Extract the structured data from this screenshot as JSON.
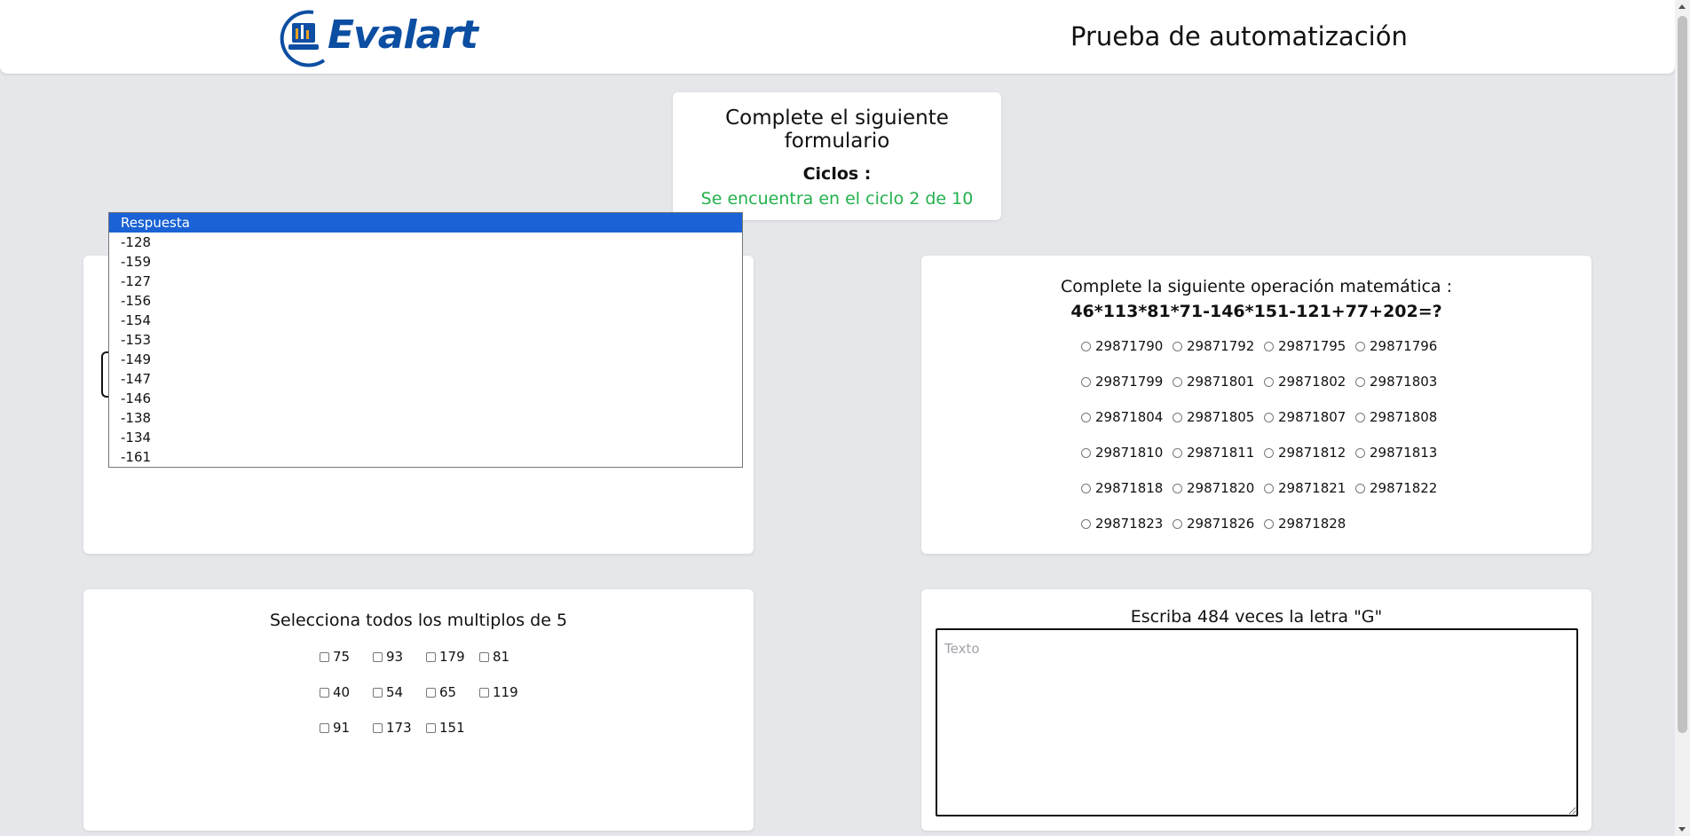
{
  "header": {
    "brand": "Evalart",
    "title": "Prueba de automatización"
  },
  "cycle": {
    "title": "Complete el siguiente formulario",
    "label": "Ciclos :",
    "status": "Se encuentra en el ciclo 2 de 10"
  },
  "dropdown": {
    "options": [
      "Respuesta",
      "-128",
      "-159",
      "-127",
      "-156",
      "-154",
      "-153",
      "-149",
      "-147",
      "-146",
      "-138",
      "-134",
      "-161"
    ],
    "selected": "Respuesta"
  },
  "math": {
    "question": "Complete la siguiente operación matemática :",
    "expression": "46*113*81*71-146*151-121+77+202=?",
    "options": [
      "29871790",
      "29871792",
      "29871795",
      "29871796",
      "29871799",
      "29871801",
      "29871802",
      "29871803",
      "29871804",
      "29871805",
      "29871807",
      "29871808",
      "29871810",
      "29871811",
      "29871812",
      "29871813",
      "29871818",
      "29871820",
      "29871821",
      "29871822",
      "29871823",
      "29871826",
      "29871828"
    ]
  },
  "multiples": {
    "question": "Selecciona todos los multiplos de 5",
    "options": [
      "75",
      "93",
      "179",
      "81",
      "40",
      "54",
      "65",
      "119",
      "91",
      "173",
      "151"
    ]
  },
  "text_task": {
    "question": "Escriba 484 veces la letra \"G\"",
    "placeholder": "Texto",
    "value": ""
  },
  "colors": {
    "accent": "#1a62d6",
    "status_green": "#22b14c",
    "brand_blue": "#0b4ea2",
    "background": "#e5e7eb"
  }
}
